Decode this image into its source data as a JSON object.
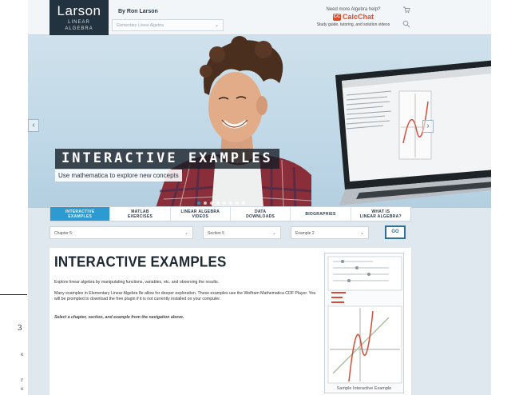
{
  "book_margin": {
    "page_number": "3",
    "fragments": [
      "e",
      "r",
      "e"
    ]
  },
  "header": {
    "logo": {
      "title": "Larson",
      "sub_line1": "LINEAR",
      "sub_line2": "ALGEBRA"
    },
    "byline": "By Ron Larson",
    "book_select": {
      "value": "Elementary Linear Algebra"
    },
    "help": {
      "question": "Need more Algebra help?",
      "brand": "CalcChat",
      "brand_icon": "CC",
      "tagline": "Study guide, tutoring, and solution videos"
    },
    "icons": [
      "cart-icon",
      "search-icon"
    ]
  },
  "hero": {
    "title": "INTERACTIVE EXAMPLES",
    "subtitle": "Use mathematica to explore new concepts",
    "slides_count": 8,
    "active_slide": 1
  },
  "tabs": [
    {
      "line1": "INTERACTIVE",
      "line2": "EXAMPLES",
      "active": true
    },
    {
      "line1": "MATLAB",
      "line2": "EXERCISES",
      "active": false
    },
    {
      "line1": "LINEAR ALGEBRA",
      "line2": "VIDEOS",
      "active": false
    },
    {
      "line1": "DATA",
      "line2": "DOWNLOADS",
      "active": false
    },
    {
      "line1": "BIOGRAPHIES",
      "line2": "",
      "active": false
    },
    {
      "line1": "WHAT IS",
      "line2": "LINEAR ALGEBRA?",
      "active": false
    }
  ],
  "selectors": {
    "chapter": "Chapter 5:",
    "section": "Section 5",
    "example": "Example 2",
    "go_label": "GO"
  },
  "content": {
    "heading": "INTERACTIVE EXAMPLES",
    "para1": "Explore linear algebra by manipulating functions, variables, etc. and observing the results.",
    "para2": "Many examples in Elementary Linear Algebra 8e allow for deeper exploration. These examples use the Wolfram Mathematica CDF Player. You will be prompted to download the free plugin if it is not currently installed on your computer.",
    "para3": "Select a chapter, section, and example from the navigation above.",
    "sample_caption": "Sample Interactive Example"
  },
  "colors": {
    "accent": "#2d9bd1",
    "logo_bg": "#23323f",
    "calcchat": "#e04b2a",
    "go_border": "#2d6f96"
  }
}
